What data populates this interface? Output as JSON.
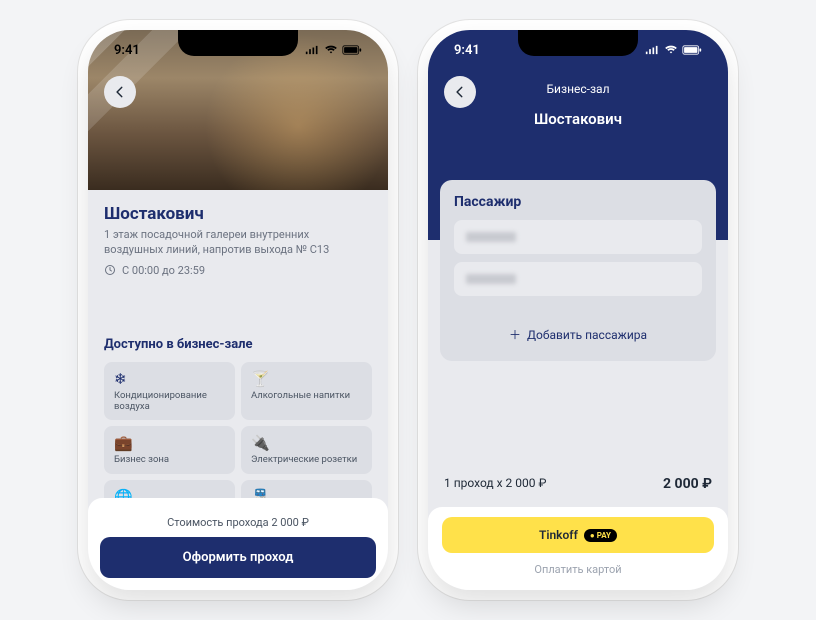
{
  "status": {
    "time": "9:41"
  },
  "phone1": {
    "title": "Шостакович",
    "subtitle": "1 этаж посадочной галереи внутренних воздушных линий, напротив выхода № С13",
    "hours": "С 00:00 до 23:59",
    "amenities_title": "Доступно в бизнес-зале",
    "amenities": [
      {
        "icon": "❄",
        "label": "Кондиционирование воздуха"
      },
      {
        "icon": "🍸",
        "label": "Алкогольные напитки"
      },
      {
        "icon": "💼",
        "label": "Бизнес зона"
      },
      {
        "icon": "🔌",
        "label": "Электрические розетки"
      },
      {
        "icon": "🌐",
        "label": ""
      },
      {
        "icon": "🚆",
        "label": ""
      }
    ],
    "price_label": "Стоимость прохода 2 000",
    "cta": "Оформить проход"
  },
  "phone2": {
    "header": "Бизнес-зал",
    "subheader": "Шостакович",
    "passenger_title": "Пассажир",
    "add_passenger": "Добавить пассажира",
    "summary_left": "1 проход х 2 000",
    "summary_total": "2 000",
    "tinkoff": "Tinkoff",
    "pay_pill": "PAY",
    "pay_card": "Оплатить картой"
  }
}
